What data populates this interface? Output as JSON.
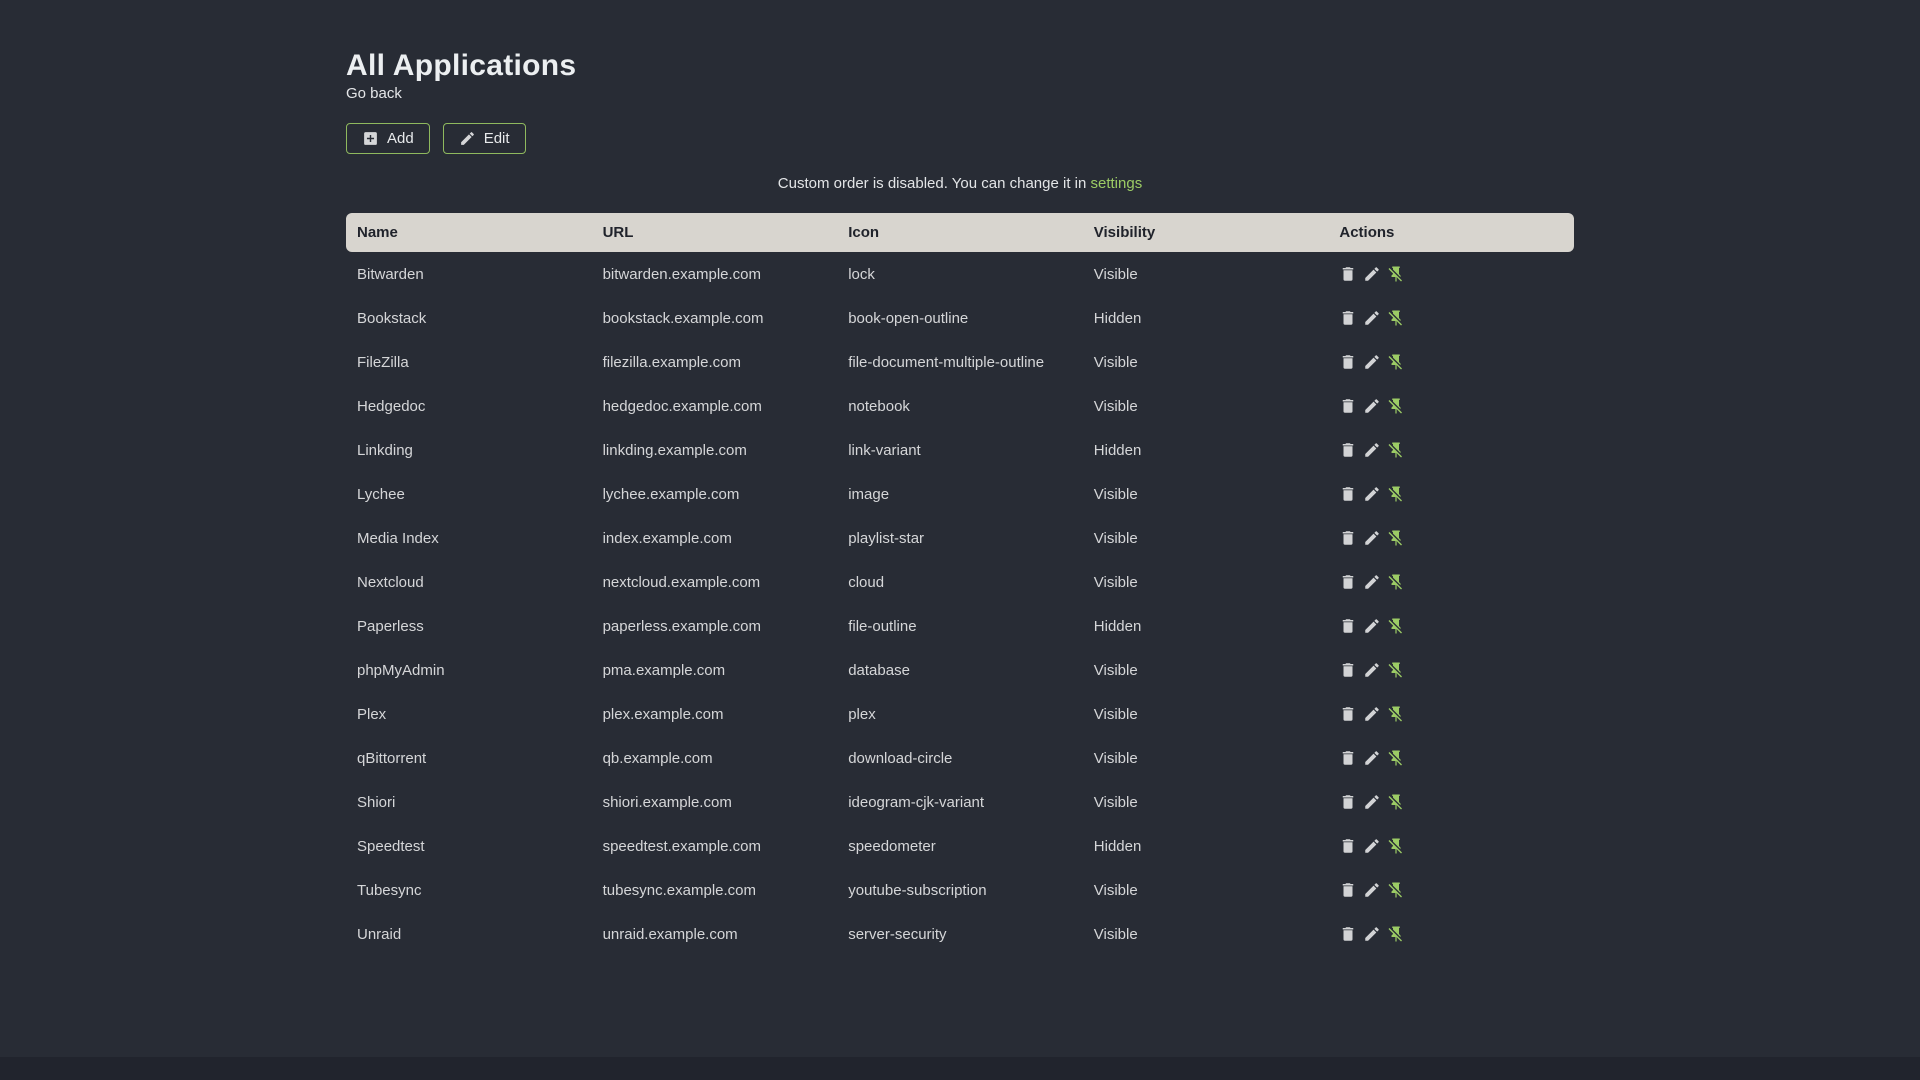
{
  "header": {
    "title": "All Applications",
    "back_link": "Go back"
  },
  "toolbar": {
    "add_label": "Add",
    "edit_label": "Edit",
    "add_icon": "plus-box-icon",
    "edit_icon": "pencil-icon"
  },
  "notice": {
    "text": "Custom order is disabled. You can change it in",
    "link_label": "settings"
  },
  "table": {
    "columns": [
      "Name",
      "URL",
      "Icon",
      "Visibility",
      "Actions"
    ],
    "row_action_icons": [
      "delete-icon",
      "pencil-icon",
      "pin-off-icon"
    ],
    "rows": [
      {
        "name": "Bitwarden",
        "url": "bitwarden.example.com",
        "icon": "lock",
        "visibility": "Visible"
      },
      {
        "name": "Bookstack",
        "url": "bookstack.example.com",
        "icon": "book-open-outline",
        "visibility": "Hidden"
      },
      {
        "name": "FileZilla",
        "url": "filezilla.example.com",
        "icon": "file-document-multiple-outline",
        "visibility": "Visible"
      },
      {
        "name": "Hedgedoc",
        "url": "hedgedoc.example.com",
        "icon": "notebook",
        "visibility": "Visible"
      },
      {
        "name": "Linkding",
        "url": "linkding.example.com",
        "icon": "link-variant",
        "visibility": "Hidden"
      },
      {
        "name": "Lychee",
        "url": "lychee.example.com",
        "icon": "image",
        "visibility": "Visible"
      },
      {
        "name": "Media Index",
        "url": "index.example.com",
        "icon": "playlist-star",
        "visibility": "Visible"
      },
      {
        "name": "Nextcloud",
        "url": "nextcloud.example.com",
        "icon": "cloud",
        "visibility": "Visible"
      },
      {
        "name": "Paperless",
        "url": "paperless.example.com",
        "icon": "file-outline",
        "visibility": "Hidden"
      },
      {
        "name": "phpMyAdmin",
        "url": "pma.example.com",
        "icon": "database",
        "visibility": "Visible"
      },
      {
        "name": "Plex",
        "url": "plex.example.com",
        "icon": "plex",
        "visibility": "Visible"
      },
      {
        "name": "qBittorrent",
        "url": "qb.example.com",
        "icon": "download-circle",
        "visibility": "Visible"
      },
      {
        "name": "Shiori",
        "url": "shiori.example.com",
        "icon": "ideogram-cjk-variant",
        "visibility": "Visible"
      },
      {
        "name": "Speedtest",
        "url": "speedtest.example.com",
        "icon": "speedometer",
        "visibility": "Hidden"
      },
      {
        "name": "Tubesync",
        "url": "tubesync.example.com",
        "icon": "youtube-subscription",
        "visibility": "Visible"
      },
      {
        "name": "Unraid",
        "url": "unraid.example.com",
        "icon": "server-security",
        "visibility": "Visible"
      }
    ]
  },
  "colors": {
    "background": "#282c35",
    "page_bottom": "#21242d",
    "table_header_bg": "#d8d5cf",
    "table_header_text": "#20232b",
    "body_text": "#d5d6d8",
    "accent_green": "#9ccc65"
  }
}
